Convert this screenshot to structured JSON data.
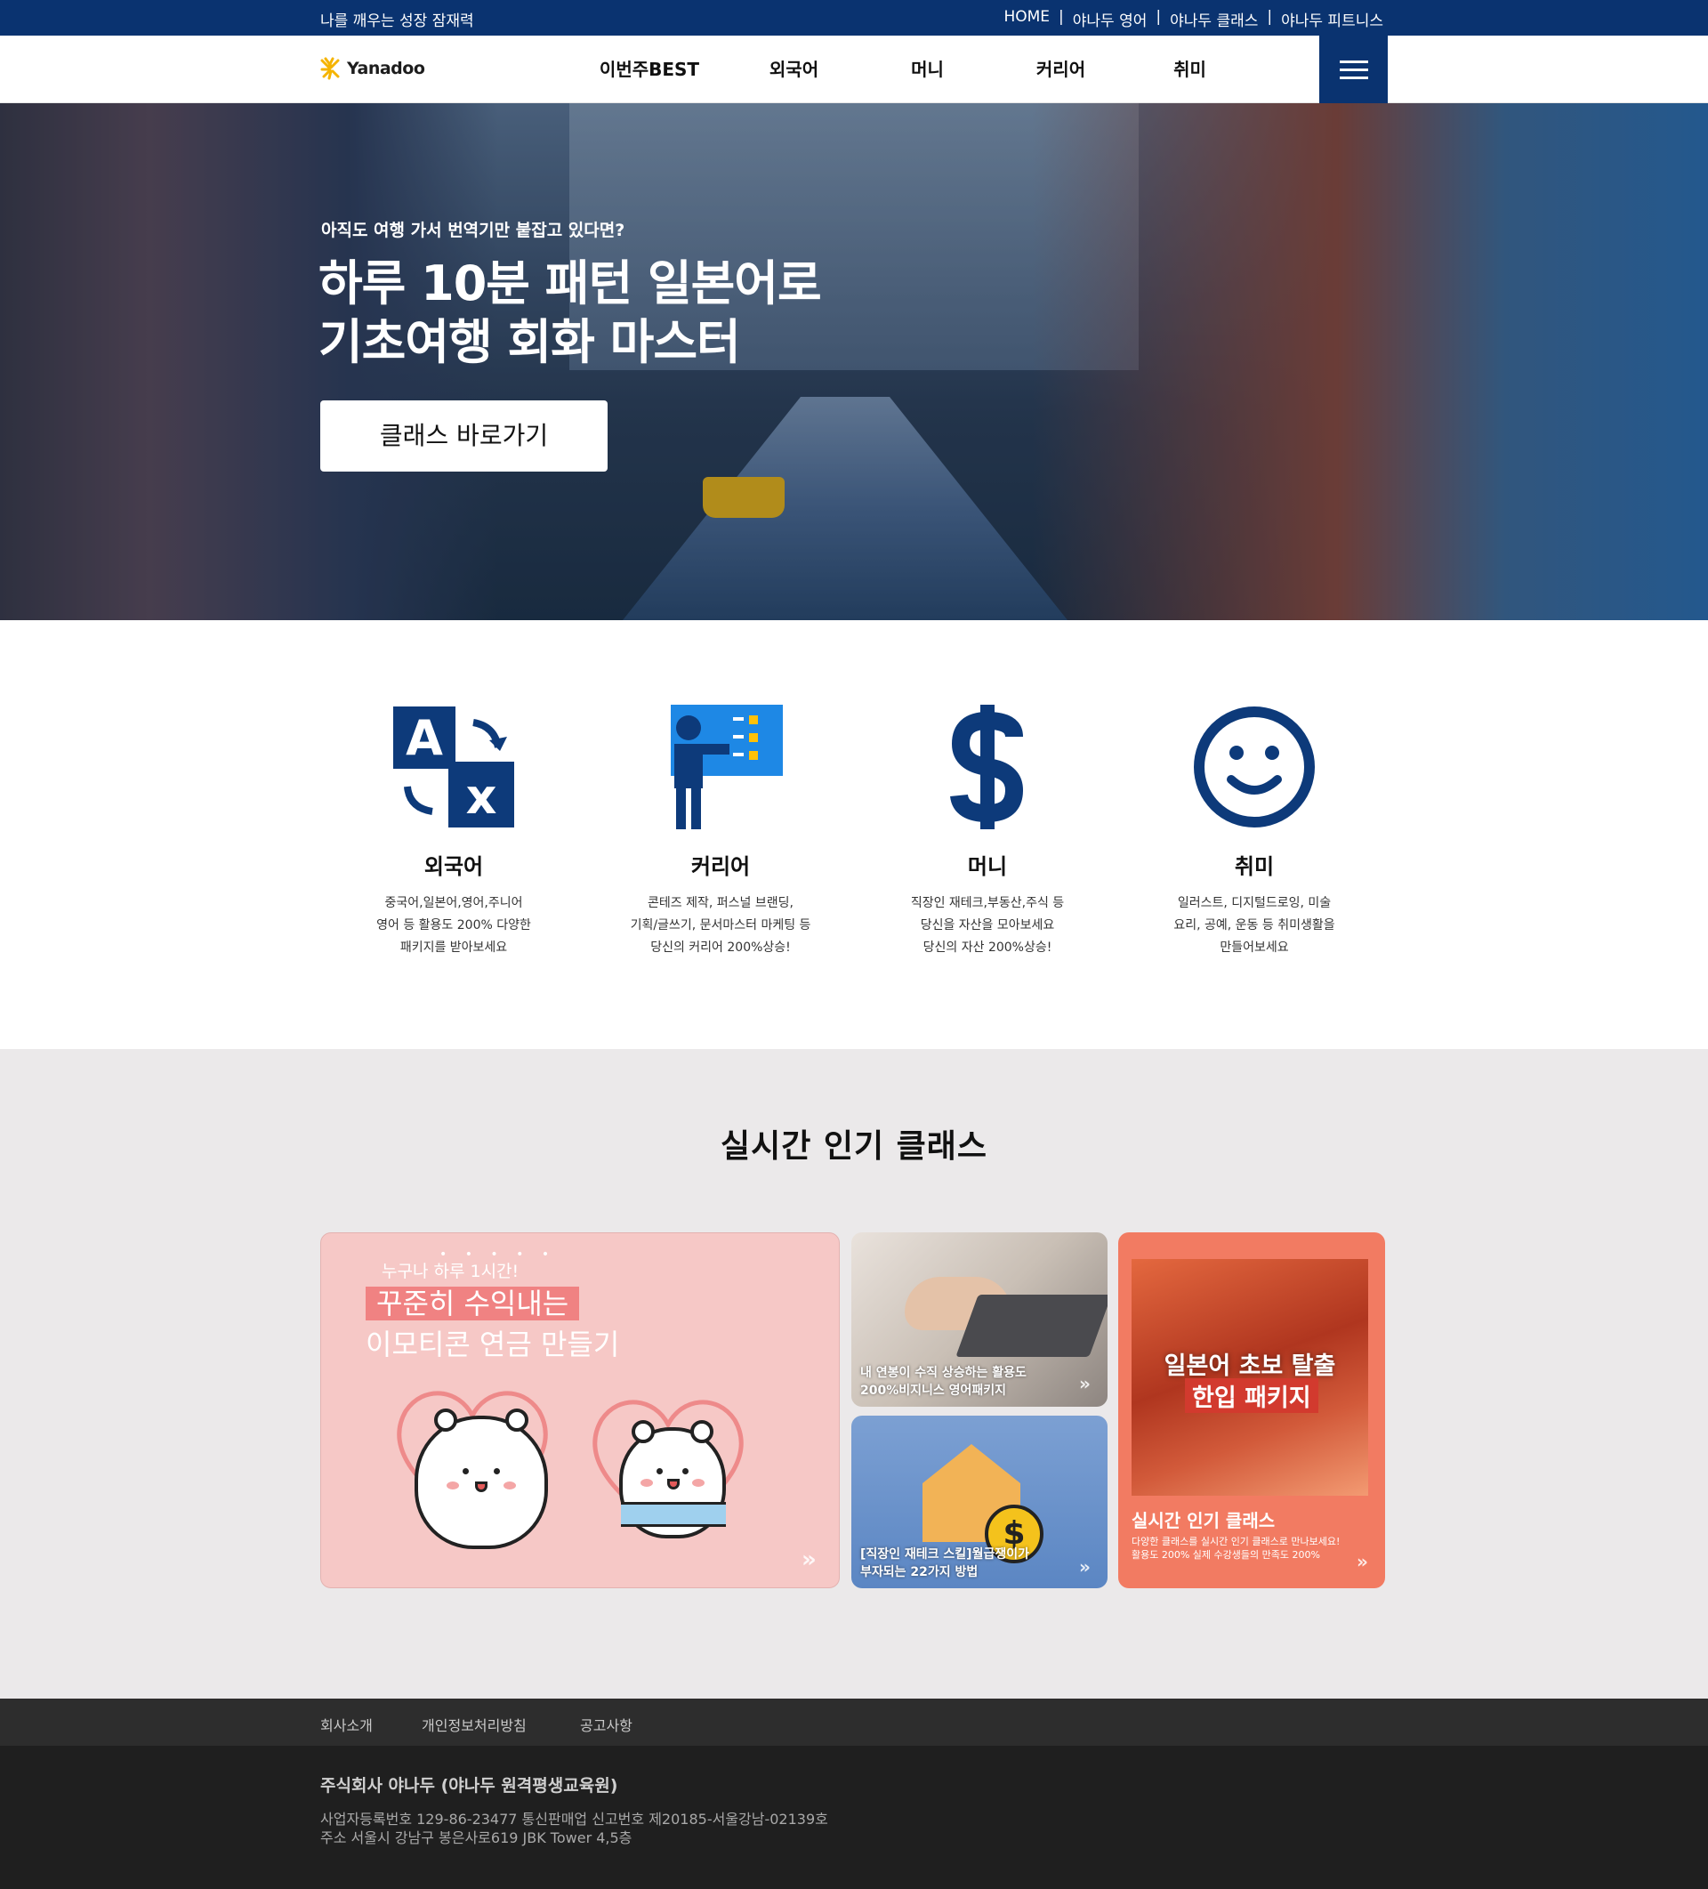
{
  "topbar": {
    "tagline": "나를 깨우는 성장 잠재력",
    "links": [
      "HOME",
      "야나두 영어",
      "야나두 클래스",
      "야나두 피트니스"
    ],
    "separator": "|"
  },
  "header": {
    "logo_text": "Yanadoo",
    "nav": [
      "이번주BEST",
      "외국어",
      "머니",
      "커리어",
      "취미"
    ],
    "menu_icon": "hamburger-icon"
  },
  "hero": {
    "subtitle": "아직도 여행 가서 번역기만 붙잡고 있다면?",
    "title_line1": "하루 10분 패턴 일본어로",
    "title_line2": "기초여행 회화 마스터",
    "button": "클래스 바로가기"
  },
  "categories": [
    {
      "icon": "translate-icon",
      "title": "외국어",
      "desc": [
        "중국어,일본어,영어,주니어",
        "영어 등 활용도 200% 다양한",
        "패키지를 받아보세요"
      ]
    },
    {
      "icon": "presentation-icon",
      "title": "커리어",
      "desc": [
        "콘테즈 제작, 퍼스널 브랜딩,",
        "기획/글쓰기, 문서마스터 마케팅 등",
        "당신의 커리어 200%상승!"
      ]
    },
    {
      "icon": "dollar-icon",
      "title": "머니",
      "desc": [
        "직장인 재테크,부동산,주식 등",
        "당신을 자산을 모아보세요",
        "당신의 자산 200%상승!"
      ]
    },
    {
      "icon": "smile-icon",
      "title": "취미",
      "desc": [
        "일러스트, 디지털드로잉, 미술",
        "요리, 공예, 운동 등 취미생활을",
        "만들어보세요"
      ]
    }
  ],
  "popular": {
    "title": "실시간 인기 클래스",
    "big_card": {
      "small": "누구나 하루 1시간!",
      "highlight": "꾸준히 수익내는",
      "line2": "이모티콘 연금 만들기"
    },
    "small_card1": [
      "내 연봉이 수직 상승하는 활용도",
      "200%비지니스 영어패키지"
    ],
    "small_card2": [
      "[직장인 재테크 스킬]월급쟁이가",
      "부자되는 22가지 방법"
    ],
    "tall_card": {
      "photo_line1": "일본어 초보 탈출",
      "photo_line2": "한입 패키지",
      "title": "실시간 인기 클래스",
      "desc_line1": "다양한 클래스를 실시간 인기 클래스로 만나보세요!",
      "desc_line2": "활용도 200% 실제 수강생들의 만족도 200%"
    }
  },
  "footer": {
    "links": [
      "회사소개",
      "개인정보처리방침",
      "공고사항"
    ],
    "company": "주식회사 야나두 (야나두 원격평생교육원)",
    "info_line1": "사업자등록번호 129-86-23477 통신판매업 신고번호 제20185-서울강남-02139호",
    "info_line2": "주소 서울시 강남구 봉은사로619 JBK Tower 4,5층"
  },
  "colors": {
    "brand_navy": "#0a3370",
    "popular_bg": "#ebe9ea",
    "footer_bg": "#1f1f1f"
  }
}
